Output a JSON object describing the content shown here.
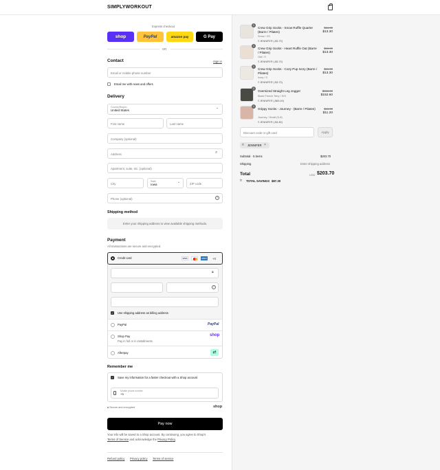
{
  "brand": "SIMPLYWORKOUT",
  "express": {
    "label": "Express checkout",
    "or": "OR",
    "shop": "shop",
    "paypal": "PayPal",
    "amazon": "amazon pay",
    "gpay": "G Pay"
  },
  "contact": {
    "title": "Contact",
    "signin": "Sign in",
    "email_placeholder": "Email or mobile phone number",
    "news": "Email me with news and offers"
  },
  "delivery": {
    "title": "Delivery",
    "country_label": "Country/Region",
    "country": "United States",
    "first": "First name",
    "last": "Last name",
    "company": "Company (optional)",
    "address": "Address",
    "apt": "Apartment, suite, etc. (optional)",
    "city": "City",
    "state_label": "State",
    "state": "Iowa",
    "zip": "ZIP code",
    "phone": "Phone (optional)"
  },
  "shipping": {
    "title": "Shipping method",
    "note": "Enter your shipping address to view available shipping methods."
  },
  "payment": {
    "title": "Payment",
    "sub": "All transactions are secure and encrypted.",
    "cc": "Credit card",
    "more": "+4",
    "billing": "Use shipping address as billing address",
    "paypal": "PayPal",
    "shoppay": "Shop Pay",
    "shoppay_sub": "Pay in full or in installments",
    "afterpay": "Afterpay"
  },
  "remember": {
    "title": "Remember me",
    "save": "Save my information for a faster checkout with a Shop account",
    "phone_label": "Mobile phone number",
    "phone": "+1",
    "secure": "Secure and encrypted",
    "shop": "shop"
  },
  "paynow": "Pay now",
  "legal": {
    "text1": "Your info will be saved to a Shop account. By continuing, you agree to Shop's",
    "terms": "Terms of Service",
    "and": "and acknowledge the",
    "privacy": "Privacy Policy",
    "dot": "."
  },
  "footer": {
    "refund": "Refund policy",
    "privacy": "Privacy policy",
    "terms": "Terms of service"
  },
  "items": [
    {
      "qty": "1",
      "name": "Crew Grip Socks - Snow Ruffle Quarter (Barre / Pilates)",
      "variant": "Snow / XS",
      "disc": "JENNIFER (-$3.70)",
      "old": "$16.99",
      "price": "$13.30"
    },
    {
      "qty": "1",
      "name": "Crew Grip Socks - Heart Ruffle Oat (Barre / Pilates)",
      "variant": "Oat / S",
      "disc": "JENNIFER (-$3.70)",
      "old": "$16.99",
      "price": "$13.30"
    },
    {
      "qty": "1",
      "name": "Crew Grip Socks - Cozy Pup Ivory (Barre / Pilates)",
      "variant": "Ivory / S",
      "disc": "JENNIFER (-$3.70)",
      "old": "$16.99",
      "price": "$13.30"
    },
    {
      "qty": "1",
      "name": "Oversized Straight Leg Jogger",
      "variant": "Black French Terry / S/S",
      "disc": "JENNIFER (-$65.40)",
      "old": "$218.00",
      "price": "$152.60"
    },
    {
      "qty": "1",
      "name": "Grippy Socks - Journey - (Barre / Pilates)",
      "variant": "Journey / Small (S-8)",
      "disc": "JENNIFER (-$4.80)",
      "old": "$16.00",
      "price": "$11.20"
    }
  ],
  "discount": {
    "placeholder": "Discount code or gift card",
    "apply": "Apply",
    "tag": "JENNIFER"
  },
  "summary": {
    "subtotal_label": "Subtotal · 5 items",
    "subtotal": "$203.70",
    "shipping_label": "Shipping",
    "shipping": "Enter shipping address",
    "total_label": "Total",
    "currency": "USD",
    "total": "$203.70",
    "savings_label": "TOTAL SAVINGS",
    "savings": "$87.30"
  },
  "colors": {
    "shop": "#5a31f4",
    "paypal": "#ffc439",
    "amazon": "#ffd814",
    "gpay": "#000000",
    "pay": "#000000"
  }
}
